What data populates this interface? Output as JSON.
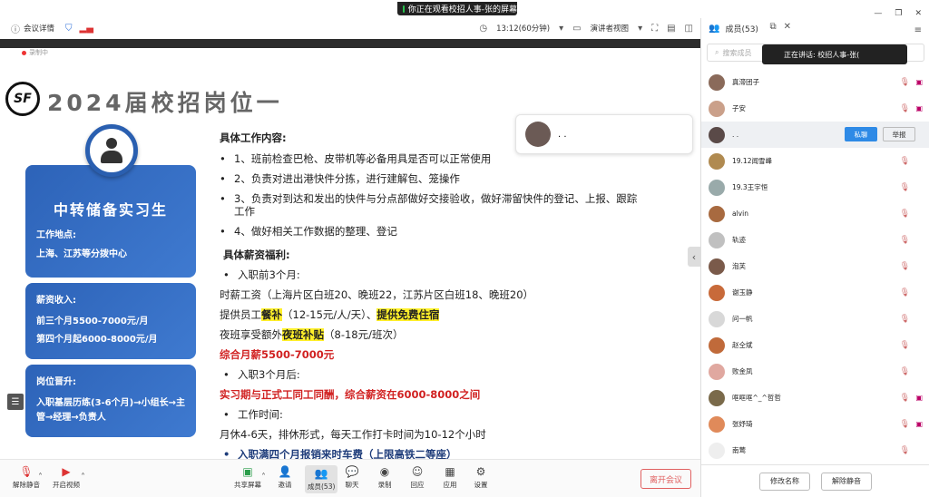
{
  "share_banner": "你正在观看校招人事-张的屏幕",
  "topbar": {
    "meeting_details": "会议详情",
    "time": "13:12(60分钟)",
    "view_mode": "演讲者视图"
  },
  "recording": "录制中",
  "slide": {
    "logo_text": "SF",
    "title": "2024届校招岗位一",
    "card1": {
      "title": "中转储备实习生",
      "location_label": "工作地点:",
      "location": "上海、江苏等分拨中心"
    },
    "card2": {
      "label": "薪资收入:",
      "line1": "前三个月5500-7000元/月",
      "line2": "第四个月起6000-8000元/月"
    },
    "card3": {
      "label": "岗位晋升:",
      "text": "入职基层历练(3-6个月)→小组长→主管→经理→负责人"
    },
    "work_heading": "具体工作内容:",
    "work_items": [
      "1、班前检查巴枪、皮带机等必备用具是否可以正常使用",
      "2、负责对进出港快件分拣，进行建解包、笼操作",
      "3、负责对到达和发出的快件与分点部做好交接验收，做好滞留快件的登记、上报、跟踪工作",
      "4、做好相关工作数据的整理、登记"
    ],
    "benefit_heading": "具体薪资福利:",
    "first3": "入职前3个月:",
    "hourly": "时薪工资（上海片区白班20、晚班22，江苏片区白班18、晚班20）",
    "meal_a": "提供员工",
    "meal_b": "餐补",
    "meal_c": "（12-15元/人/天）、",
    "meal_d": "提供免费住宿",
    "night_a": "夜班享受额外",
    "night_b": "夜班补贴",
    "night_c": "（8-18元/班次）",
    "total": "综合月薪5500-7000元",
    "after3": "入职3个月后:",
    "intern": "实习期与正式工同工同酬，综合薪资在6000-8000之间",
    "worktime_label": "工作时间:",
    "worktime": "月休4-6天，排休形式，每天工作打卡时间为10-12个小时",
    "commute": "入职满四个月报销来时车费（上限高铁二等座）"
  },
  "speaker_tile_name": ". .",
  "bottombar": {
    "unmute": "解除静音",
    "start_video": "开启视频",
    "share_screen": "共享屏幕",
    "invite": "邀请",
    "members": "成员(53)",
    "chat": "聊天",
    "record": "录制",
    "apps_a": "回应",
    "apps_b": "应用",
    "settings": "设置",
    "leave": "离开会议"
  },
  "panel": {
    "title": "成员(53)",
    "search_placeholder": "搜索成员",
    "speaking": "正在讲话:  校招人事-张(",
    "private_chat": "私聊",
    "report": "举报",
    "rename": "修改名称",
    "unmute_all": "解除静音",
    "members": [
      {
        "name": "真滞团子",
        "color": "#8a6a5a"
      },
      {
        "name": "子安",
        "color": "#caa08a"
      },
      {
        "name": ". .",
        "color": "#5a4a48"
      },
      {
        "name": "19.12闻雪峰",
        "color": "#b08a50"
      },
      {
        "name": "19.3王宇恒",
        "color": "#9aa"
      },
      {
        "name": "alvin",
        "color": "#a86a40"
      },
      {
        "name": "轨迹",
        "color": "#c0c0c0"
      },
      {
        "name": "泡芙",
        "color": "#7a5a4a"
      },
      {
        "name": "谢玉静",
        "color": "#c86a3a"
      },
      {
        "name": "问一帆",
        "color": "#d8d8d8"
      },
      {
        "name": "赵仝斌",
        "color": "#c06a3a"
      },
      {
        "name": "败金凤",
        "color": "#e0a8a0"
      },
      {
        "name": "哐哐哐^_^哲哲",
        "color": "#7a6a4a"
      },
      {
        "name": "张妤琦",
        "color": "#e08a5a"
      },
      {
        "name": "南莺",
        "color": "#eee"
      }
    ]
  }
}
